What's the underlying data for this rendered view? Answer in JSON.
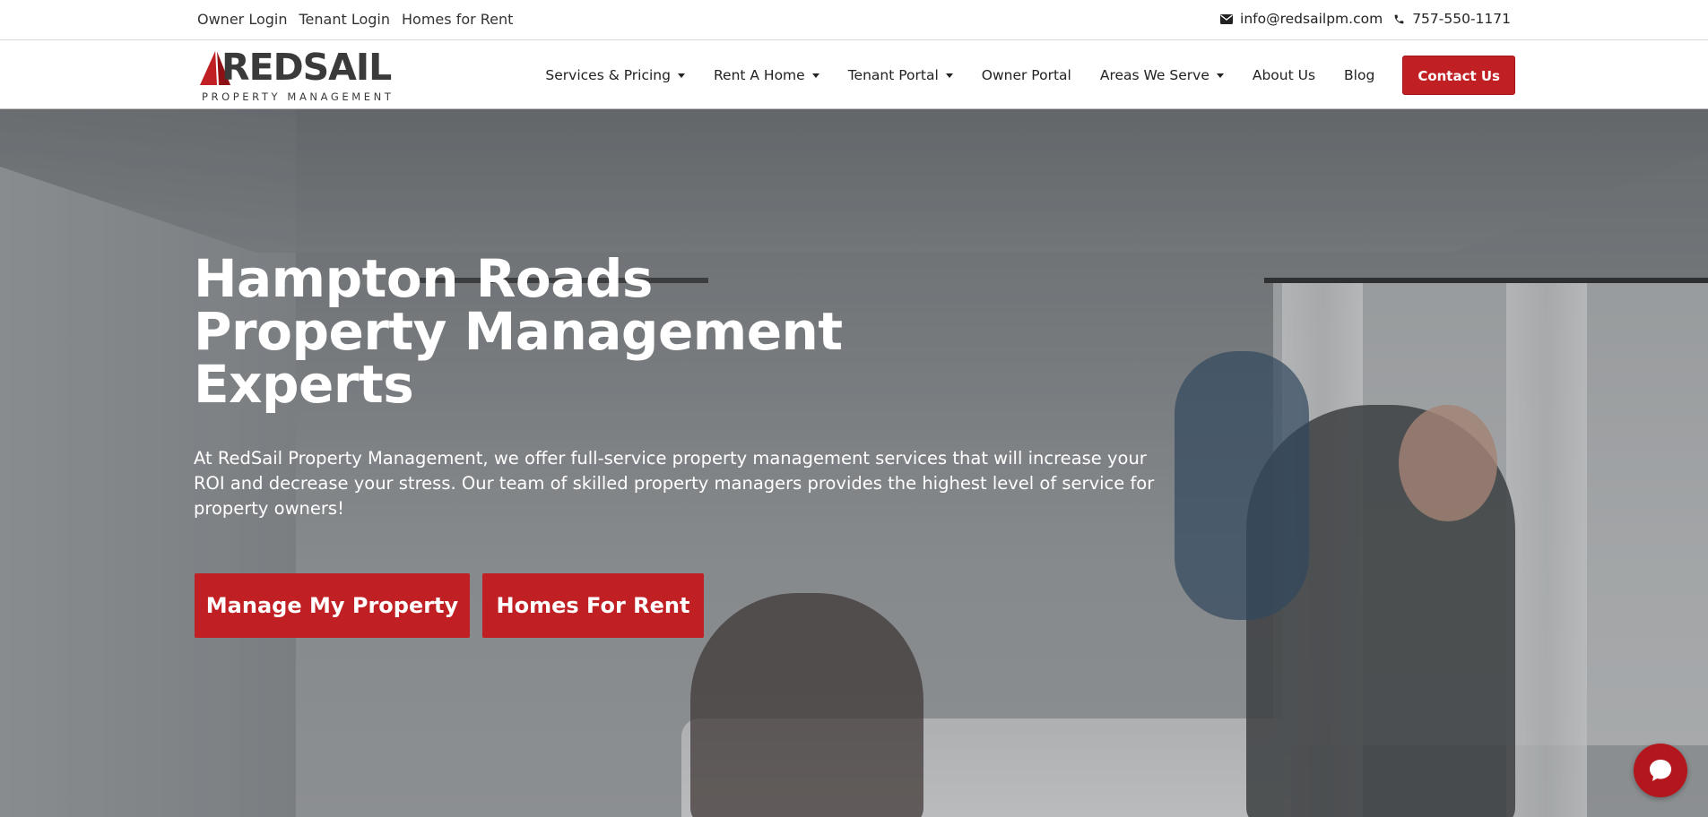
{
  "topbar": {
    "links": [
      "Owner Login",
      "Tenant Login",
      "Homes for Rent"
    ],
    "email": "info@redsailpm.com",
    "phone": "757-550-1171"
  },
  "logo": {
    "name": "REDSAIL",
    "subtitle": "PROPERTY MANAGEMENT"
  },
  "nav": {
    "items": [
      {
        "label": "Services & Pricing",
        "dropdown": true
      },
      {
        "label": "Rent A Home",
        "dropdown": true
      },
      {
        "label": "Tenant Portal",
        "dropdown": true
      },
      {
        "label": "Owner Portal",
        "dropdown": false
      },
      {
        "label": "Areas We Serve",
        "dropdown": true
      },
      {
        "label": "About Us",
        "dropdown": false
      },
      {
        "label": "Blog",
        "dropdown": false
      }
    ],
    "cta": "Contact Us"
  },
  "hero": {
    "title_lines": [
      "Hampton Roads",
      "Property Management",
      "Experts"
    ],
    "description": "At RedSail Property Management, we offer full-service property management services that will increase your ROI and decrease your stress. Our team of skilled property managers provides the highest level of service for property owners!",
    "buttons": [
      "Manage My Property",
      "Homes For Rent"
    ]
  },
  "icons": {
    "email": "envelope-icon",
    "phone": "phone-icon",
    "chat": "chat-bubble-icon",
    "caret": "caret-down-icon"
  },
  "colors": {
    "brand_red": "#c01f24",
    "text_dark": "#222222",
    "logo_gray": "#3a3a3a"
  }
}
